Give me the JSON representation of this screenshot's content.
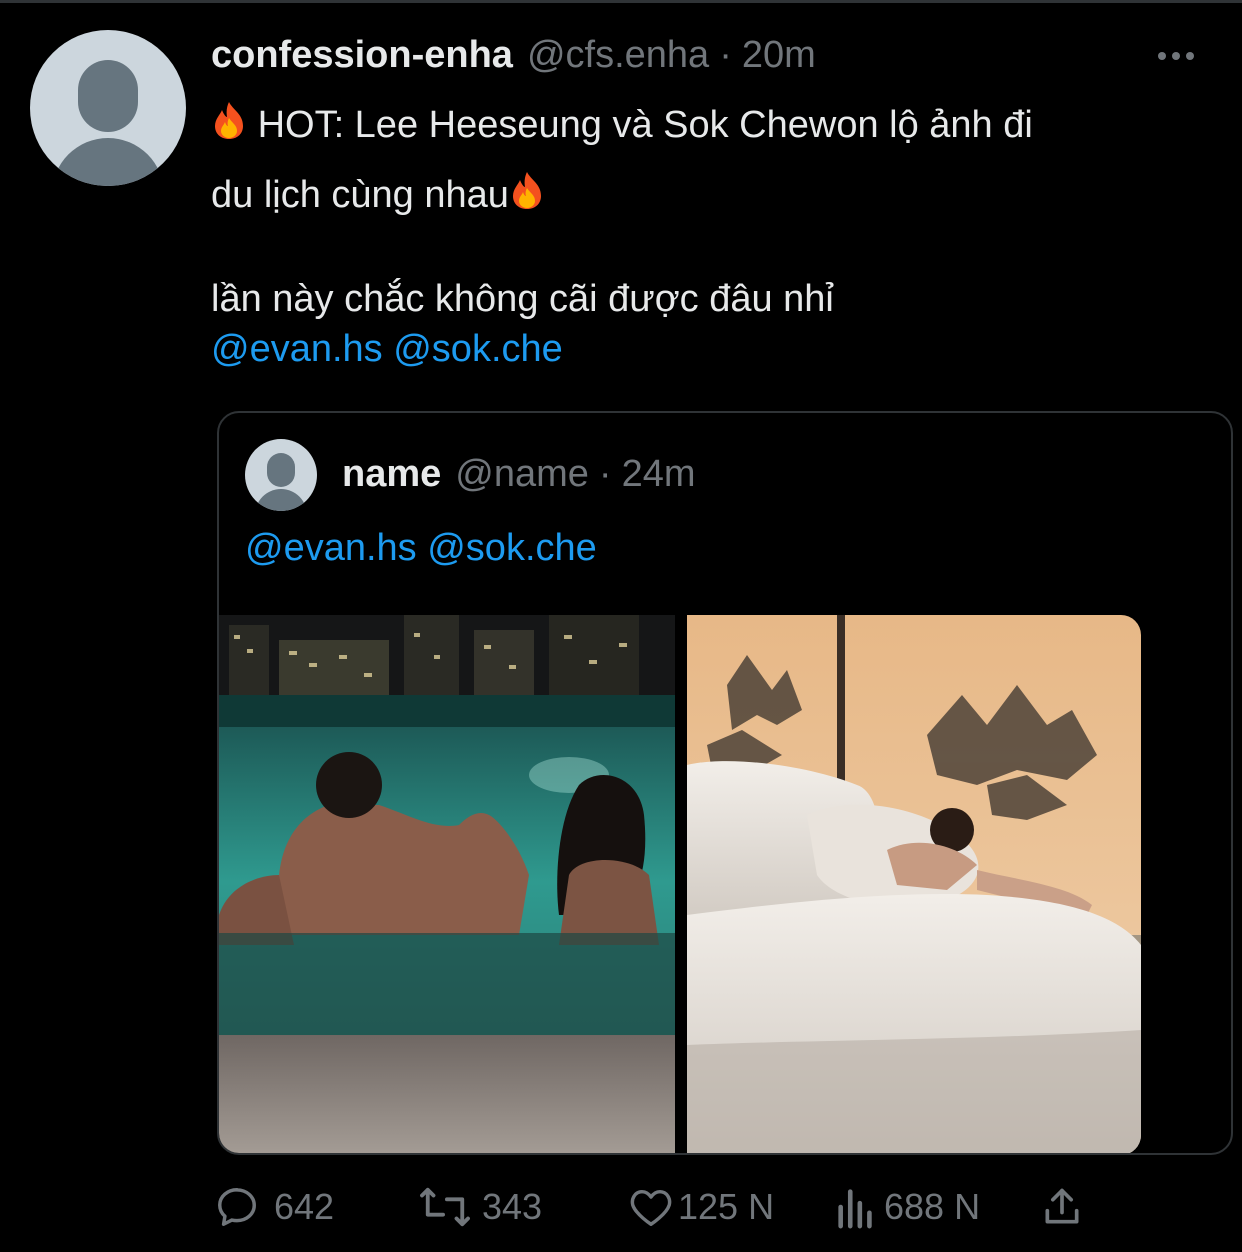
{
  "tweet": {
    "username": "confession-enha",
    "handle": "@cfs.enha",
    "separator": "·",
    "time": "20m",
    "line1": "HOT: Lee Heeseung và Sok Chewon lộ ảnh đi",
    "line2": "du lịch cùng nhau",
    "line3": "lần này chắc không cãi được đâu nhỉ",
    "mention1": "@evan.hs",
    "mention2": "@sok.che",
    "emoji": "fire-emoji"
  },
  "quote": {
    "username": "name",
    "handle": "@name",
    "separator": "·",
    "time": "24m",
    "mention1": "@evan.hs",
    "mention2": "@sok.che",
    "images": [
      "night pool photo",
      "bedroom window photo"
    ]
  },
  "actions": {
    "reply_count": "642",
    "retweet_count": "343",
    "like_count": "125 N",
    "view_count": "688 N"
  },
  "colors": {
    "background": "#000000",
    "text": "#e7e9ea",
    "muted": "#71767b",
    "link": "#1d9bf0",
    "border": "#2f3336"
  }
}
